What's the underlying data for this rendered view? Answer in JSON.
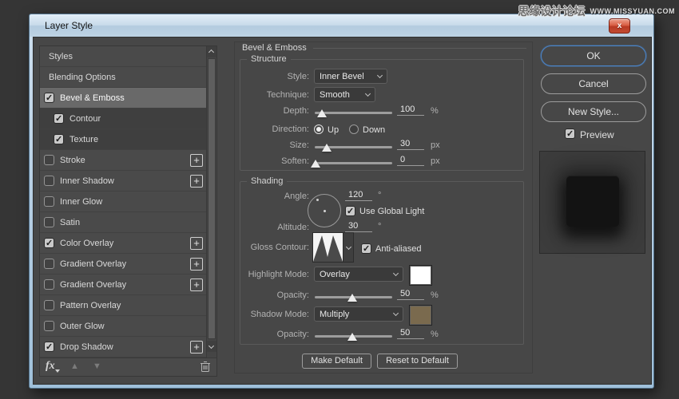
{
  "watermark": {
    "cn": "思缘设计论坛",
    "en": "WWW.MISSYUAN.COM"
  },
  "dialog": {
    "title": "Layer Style",
    "close_label": "x"
  },
  "styles_panel": {
    "items": [
      {
        "label": "Styles",
        "checked": null,
        "selected": false,
        "sub": false,
        "plus": false
      },
      {
        "label": "Blending Options",
        "checked": null,
        "selected": false,
        "sub": false,
        "plus": false
      },
      {
        "label": "Bevel & Emboss",
        "checked": true,
        "selected": true,
        "sub": false,
        "plus": false
      },
      {
        "label": "Contour",
        "checked": true,
        "selected": false,
        "sub": true,
        "plus": false
      },
      {
        "label": "Texture",
        "checked": true,
        "selected": false,
        "sub": true,
        "plus": false
      },
      {
        "label": "Stroke",
        "checked": false,
        "selected": false,
        "sub": false,
        "plus": true
      },
      {
        "label": "Inner Shadow",
        "checked": false,
        "selected": false,
        "sub": false,
        "plus": true
      },
      {
        "label": "Inner Glow",
        "checked": false,
        "selected": false,
        "sub": false,
        "plus": false
      },
      {
        "label": "Satin",
        "checked": false,
        "selected": false,
        "sub": false,
        "plus": false
      },
      {
        "label": "Color Overlay",
        "checked": true,
        "selected": false,
        "sub": false,
        "plus": true
      },
      {
        "label": "Gradient Overlay",
        "checked": false,
        "selected": false,
        "sub": false,
        "plus": true
      },
      {
        "label": "Gradient Overlay",
        "checked": false,
        "selected": false,
        "sub": false,
        "plus": true
      },
      {
        "label": "Pattern Overlay",
        "checked": false,
        "selected": false,
        "sub": false,
        "plus": false
      },
      {
        "label": "Outer Glow",
        "checked": false,
        "selected": false,
        "sub": false,
        "plus": false
      },
      {
        "label": "Drop Shadow",
        "checked": true,
        "selected": false,
        "sub": false,
        "plus": true
      }
    ],
    "footer": {
      "fx_label": "fx"
    }
  },
  "main": {
    "section_title": "Bevel & Emboss",
    "structure": {
      "title": "Structure",
      "style_label": "Style:",
      "style_value": "Inner Bevel",
      "technique_label": "Technique:",
      "technique_value": "Smooth",
      "depth_label": "Depth:",
      "depth_value": "100",
      "depth_unit": "%",
      "direction_label": "Direction:",
      "direction_up": "Up",
      "direction_down": "Down",
      "direction_selected": "Up",
      "size_label": "Size:",
      "size_value": "30",
      "size_unit": "px",
      "soften_label": "Soften:",
      "soften_value": "0",
      "soften_unit": "px"
    },
    "shading": {
      "title": "Shading",
      "angle_label": "Angle:",
      "angle_value": "120",
      "angle_unit": "°",
      "use_global_light_label": "Use Global Light",
      "use_global_light_checked": true,
      "altitude_label": "Altitude:",
      "altitude_value": "30",
      "altitude_unit": "°",
      "gloss_label": "Gloss Contour:",
      "gloss_contour_name": "ring",
      "anti_aliased_label": "Anti-aliased",
      "anti_aliased_checked": true,
      "highlight_mode_label": "Highlight Mode:",
      "highlight_mode_value": "Overlay",
      "highlight_color": "#ffffff",
      "opacity_highlight_label": "Opacity:",
      "opacity_highlight_value": "50",
      "opacity_highlight_unit": "%",
      "shadow_mode_label": "Shadow Mode:",
      "shadow_mode_value": "Multiply",
      "shadow_color": "#7a6a4e",
      "opacity_shadow_label": "Opacity:",
      "opacity_shadow_value": "50",
      "opacity_shadow_unit": "%"
    },
    "footer_buttons": {
      "make_default": "Make Default",
      "reset_to_default": "Reset to Default"
    }
  },
  "actions": {
    "ok": "OK",
    "cancel": "Cancel",
    "new_style": "New Style...",
    "preview_label": "Preview",
    "preview_checked": true
  },
  "colors": {
    "accent_blue": "#4a84c8",
    "close_red": "#c24c32",
    "shadow_swatch": "#7a6a4e",
    "highlight_swatch": "#ffffff"
  }
}
